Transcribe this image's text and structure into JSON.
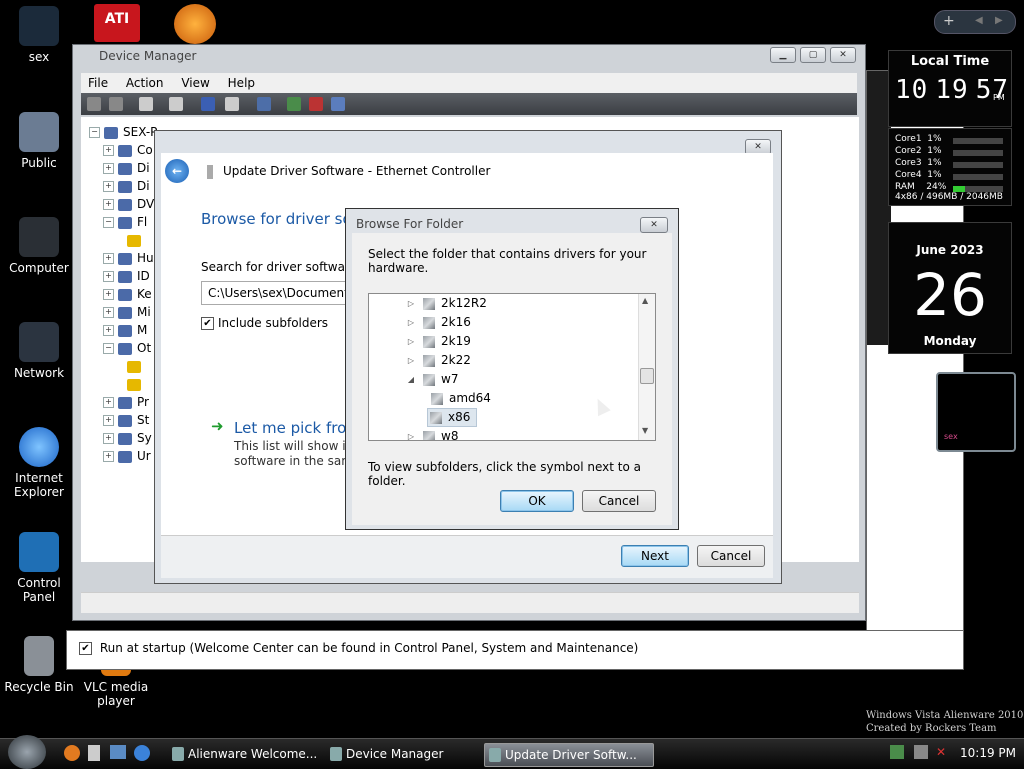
{
  "desktop": {
    "icons": [
      {
        "label": "sex",
        "icon": "user-folder-icon"
      },
      {
        "label": "Public",
        "icon": "public-folder-icon"
      },
      {
        "label": "Computer",
        "icon": "computer-icon"
      },
      {
        "label": "Network",
        "icon": "network-icon"
      },
      {
        "label": "Internet Explorer",
        "icon": "ie-icon"
      },
      {
        "label": "Control Panel",
        "icon": "control-panel-icon"
      },
      {
        "label": "Recycle Bin",
        "icon": "recycle-bin-icon"
      },
      {
        "label": "VLC media player",
        "icon": "vlc-icon"
      }
    ],
    "watermark": {
      "line1": "Windows Vista Alienware 2010",
      "line2": "Created by Rockers Team"
    }
  },
  "device_manager": {
    "title": "Device Manager",
    "menu": [
      "File",
      "Action",
      "View",
      "Help"
    ],
    "root": "SEX-P",
    "tree_items": [
      "Co",
      "Di",
      "Di",
      "DV",
      "Fl",
      "",
      "Hu",
      "ID",
      "Ke",
      "Mi",
      "M",
      "Ot",
      "",
      "",
      "Pr",
      "St",
      "Sy",
      "Ur"
    ],
    "welcome_checkbox": "Run at startup (Welcome Center can be found in Control Panel, System and Maintenance)"
  },
  "update_driver": {
    "title": "Update Driver Software - Ethernet Controller",
    "heading": "Browse for driver sof",
    "search_label": "Search for driver software in",
    "path_value": "C:\\Users\\sex\\Documents",
    "include_subfolders": "Include subfolders",
    "pick_link": "Let me pick from",
    "pick_desc1": "This list will show inst",
    "pick_desc2": "software in the same",
    "next": "Next",
    "cancel": "Cancel"
  },
  "browse_folder": {
    "title": "Browse For Folder",
    "instruction": "Select the folder that contains drivers for your hardware.",
    "folders": [
      {
        "name": "2k12R2",
        "arrow": "▷",
        "level": 0
      },
      {
        "name": "2k16",
        "arrow": "▷",
        "level": 0
      },
      {
        "name": "2k19",
        "arrow": "▷",
        "level": 0
      },
      {
        "name": "2k22",
        "arrow": "▷",
        "level": 0
      },
      {
        "name": "w7",
        "arrow": "◢",
        "level": 0
      },
      {
        "name": "amd64",
        "arrow": "",
        "level": 1
      },
      {
        "name": "x86",
        "arrow": "",
        "level": 1,
        "selected": true
      },
      {
        "name": "w8",
        "arrow": "▷",
        "level": 0
      }
    ],
    "hint": "To view subfolders, click the symbol next to a folder.",
    "ok": "OK",
    "cancel": "Cancel"
  },
  "gadgets": {
    "clock": {
      "title": "Local Time",
      "hours": "10",
      "minutes": "19",
      "seconds": "57",
      "ampm": "PM"
    },
    "cpu": {
      "cores": [
        {
          "label": "Core1",
          "value": "1%"
        },
        {
          "label": "Core2",
          "value": "1%"
        },
        {
          "label": "Core3",
          "value": "1%"
        },
        {
          "label": "Core4",
          "value": "1%"
        }
      ],
      "ram": {
        "label": "RAM",
        "value": "24%"
      },
      "summary": "4x86 / 496MB / 2046MB"
    },
    "calendar": {
      "month": "June 2023",
      "day": "26",
      "weekday": "Monday"
    },
    "slideshow_label": "sex"
  },
  "taskbar": {
    "tasks": [
      "Alienware Welcome...",
      "Device Manager",
      "Update Driver Softw..."
    ],
    "time": "10:19 PM"
  },
  "colors": {
    "accent": "#1c5aa6",
    "link_green": "#1f9b2e"
  }
}
